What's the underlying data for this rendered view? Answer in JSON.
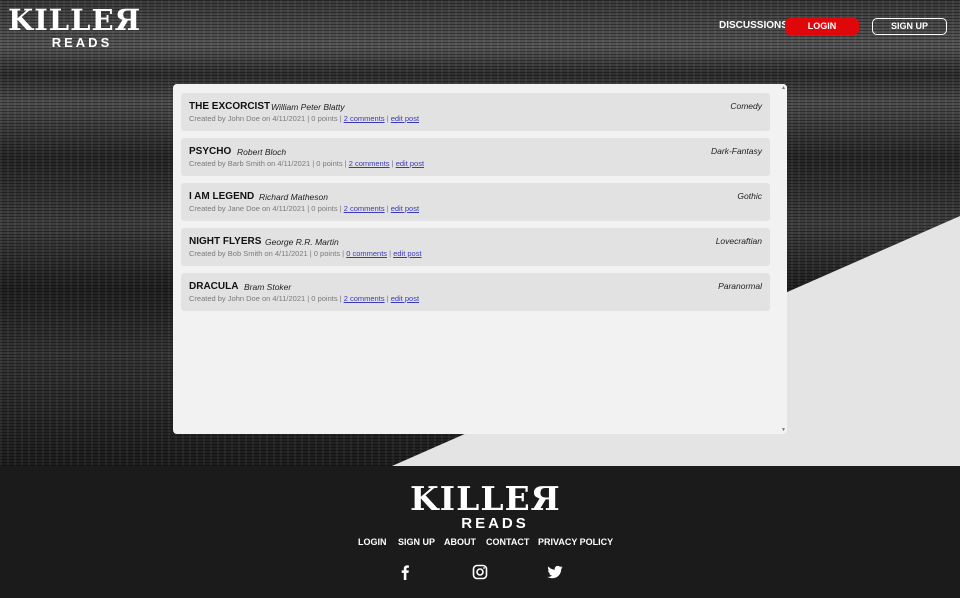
{
  "header": {
    "logo": {
      "line1": "KILLEЯ",
      "line2": "READS"
    },
    "nav": {
      "discussions": "DISCUSSIONS",
      "login": "LOGIN",
      "signup": "SIGN UP"
    }
  },
  "posts": [
    {
      "title": "THE EXCORCIST",
      "author": "William Peter Blatty",
      "genre": "Comedy",
      "created_prefix": "Created by John Doe on 4/11/2021 | 0 points |",
      "comments": "2 comments",
      "edit": "edit post"
    },
    {
      "title": "PSYCHO",
      "author": "Robert Bloch",
      "genre": "Dark-Fantasy",
      "created_prefix": "Created by Barb Smith on 4/11/2021 | 0 points |",
      "comments": "2 comments",
      "edit": "edit post"
    },
    {
      "title": "I AM LEGEND",
      "author": "Richard Matheson",
      "genre": "Gothic",
      "created_prefix": "Created by Jane Doe on 4/11/2021 | 0 points |",
      "comments": "2 comments",
      "edit": "edit post"
    },
    {
      "title": "NIGHT FLYERS",
      "author": "George R.R. Martin",
      "genre": "Lovecraftian",
      "created_prefix": "Created by Bob Smith on 4/11/2021 | 0 points |",
      "comments": "0 comments",
      "edit": "edit post"
    },
    {
      "title": "DRACULA",
      "author": "Bram Stoker",
      "genre": "Paranormal",
      "created_prefix": "Created by John Doe on 4/11/2021 | 0 points |",
      "comments": "2 comments",
      "edit": "edit post"
    }
  ],
  "footer": {
    "logo": {
      "line1": "KILLEЯ",
      "line2": "READS"
    },
    "links": {
      "login": "LOGIN",
      "signup": "SIGN UP",
      "about": "ABOUT",
      "contact": "CONTACT",
      "privacy": "PRIVACY POLICY"
    },
    "social": [
      "facebook-icon",
      "instagram-icon",
      "twitter-icon"
    ]
  },
  "colors": {
    "accent": "#e0070b",
    "panel": "#f2f2f2",
    "row": "#e2e2e2",
    "footer": "#1b1b1b",
    "link": "#3a3ab5"
  }
}
